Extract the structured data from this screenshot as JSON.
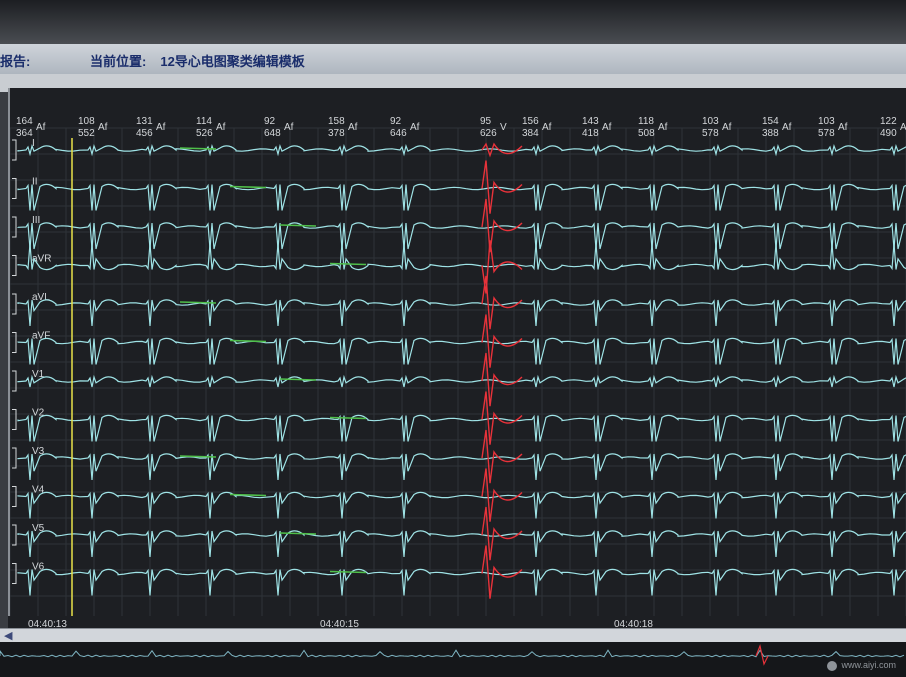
{
  "title_bar": {
    "left_text": "报告:",
    "location_label": "当前位置:",
    "location_value": "12导心电图聚类编辑模板"
  },
  "beat_annotations": [
    {
      "rate": "164",
      "interval": "364",
      "type": "Af"
    },
    {
      "rate": "108",
      "interval": "552",
      "type": "Af"
    },
    {
      "rate": "131",
      "interval": "456",
      "type": "Af"
    },
    {
      "rate": "114",
      "interval": "526",
      "type": "Af"
    },
    {
      "rate": "92",
      "interval": "648",
      "type": "Af"
    },
    {
      "rate": "158",
      "interval": "378",
      "type": "Af"
    },
    {
      "rate": "92",
      "interval": "646",
      "type": "Af"
    },
    {
      "rate": "95",
      "interval": "626",
      "type": "V"
    },
    {
      "rate": "156",
      "interval": "384",
      "type": "Af"
    },
    {
      "rate": "143",
      "interval": "418",
      "type": "Af"
    },
    {
      "rate": "118",
      "interval": "508",
      "type": "Af"
    },
    {
      "rate": "103",
      "interval": "578",
      "type": "Af"
    },
    {
      "rate": "154",
      "interval": "388",
      "type": "Af"
    },
    {
      "rate": "103",
      "interval": "578",
      "type": "Af"
    },
    {
      "rate": "122",
      "interval": "490",
      "type": "Af"
    }
  ],
  "leads": [
    "I",
    "II",
    "III",
    "aVR",
    "aVL",
    "aVF",
    "V1",
    "V2",
    "V3",
    "V4",
    "V5",
    "V6"
  ],
  "time_labels": [
    "04:40:13",
    "04:40:15",
    "04:40:18"
  ],
  "watermark": "www.aiyi.com",
  "colors": {
    "trace": "#9fe3e6",
    "highlight_segment": "#4fbf4a",
    "ventricular_beat": "#e8323a",
    "cursor": "#e9e24a",
    "grid": "#2f3338",
    "label": "#d4d7da",
    "background": "#1d1f23"
  }
}
